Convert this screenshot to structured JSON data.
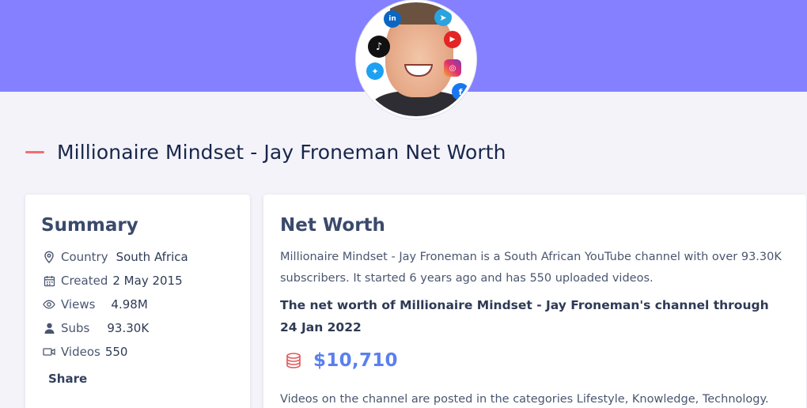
{
  "page": {
    "title": "Millionaire Mindset - Jay Froneman Net Worth"
  },
  "avatar": {
    "social_icons": [
      "linkedin-icon",
      "telegram-icon",
      "tiktok-icon",
      "youtube-icon",
      "twitter-icon",
      "instagram-icon",
      "facebook-icon"
    ],
    "linkedin_text": "in",
    "tiktok_text": "♪",
    "youtube_text": "▶",
    "twitter_text": "✦",
    "telegram_text": "➤",
    "instagram_text": "◎",
    "facebook_text": "f"
  },
  "summary": {
    "heading": "Summary",
    "rows": [
      {
        "icon": "location-pin-icon",
        "label": "Country",
        "value": "South Africa"
      },
      {
        "icon": "calendar-icon",
        "label": "Created",
        "value": "2 May 2015"
      },
      {
        "icon": "eye-icon",
        "label": "Views",
        "value": "4.98M"
      },
      {
        "icon": "user-icon",
        "label": "Subs",
        "value": "93.30K"
      },
      {
        "icon": "video-camera-icon",
        "label": "Videos",
        "value": "550"
      }
    ],
    "share_label": "Share"
  },
  "net_worth": {
    "heading": "Net Worth",
    "description": "Millionaire Mindset - Jay Froneman is a South African YouTube channel with over 93.30K subscribers. It started 6 years ago and has 550 uploaded videos.",
    "statement": "The net worth of Millionaire Mindset - Jay Froneman's channel through 24 Jan 2022",
    "value": "$10,710",
    "value_icon": "coins-stack-icon",
    "categories_text": "Videos on the channel are posted in the categories Lifestyle, Knowledge, Technology."
  },
  "colors": {
    "hero": "#8480ff",
    "accent_dash": "#f06f6f",
    "net_worth_value": "#5b80ee",
    "coins_icon": "#e25a5a"
  }
}
